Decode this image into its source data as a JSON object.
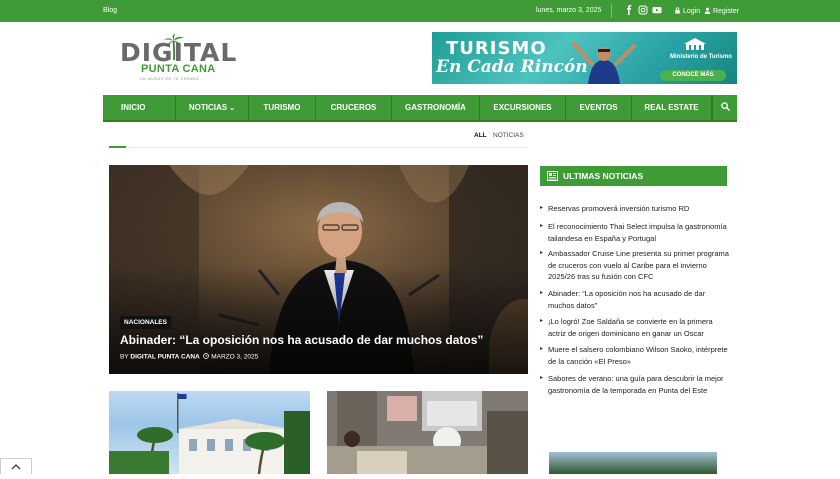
{
  "topbar": {
    "blog": "Blog",
    "date": "lunes, marzo 3, 2025",
    "login": "Login",
    "register": "Register",
    "social": [
      "facebook-icon",
      "instagram-icon",
      "youtube-icon"
    ]
  },
  "logo": {
    "line1": "DIGITAL",
    "line2": "PUNTA CANA",
    "tagline": "UN MUNDO EN TU VERANO"
  },
  "banner": {
    "line1": "TURISMO",
    "line2": "En Cada Rincón",
    "ministry": "Ministerio de Turismo",
    "cta": "CONOCE MÁS"
  },
  "nav": {
    "items": [
      "INICIO",
      "NOTICIAS",
      "TURISMO",
      "CRUCEROS",
      "GASTRONOMÍA",
      "EXCURSIONES",
      "EVENTOS",
      "REAL ESTATE"
    ],
    "dropdown_mark": "⌄"
  },
  "filters": {
    "all": "ALL",
    "noticias": "NOTICIAS"
  },
  "hero": {
    "category": "NACIONALES",
    "title": "Abinader: “La oposición nos ha acusado de dar muchos datos”",
    "by": "BY",
    "author": "DIGITAL PUNTA CANA",
    "date": "MARZO 3, 2025"
  },
  "sidebar": {
    "heading": "ULTIMAS NOTICIAS",
    "news": [
      "Reservas promoverá inversión turismo RD",
      "El reconocimiento Thai Select impulsa la gastronomía tailandesa en España y Portugal",
      "Ambassador Cruise Line presenta su primer programa de cruceros con vuelo al Caribe para el invierno 2025/26 tras su fusión con CFC",
      "Abinader: “La oposición nos ha acusado de dar muchos datos”",
      "¡Lo logró! Zoe Saldaña se convierte en la primera actriz de origen dominicano en ganar un Oscar",
      "Muere el salsero colombiano Wilson Saoko, intérprete de la canción «El Preso»",
      "Sabores de verano: una guía para descubrir la mejor gastronomía de la temporada en Punta del Este"
    ]
  },
  "colors": {
    "brand_green": "#3f9b35",
    "dark_green": "#2f7e28"
  }
}
